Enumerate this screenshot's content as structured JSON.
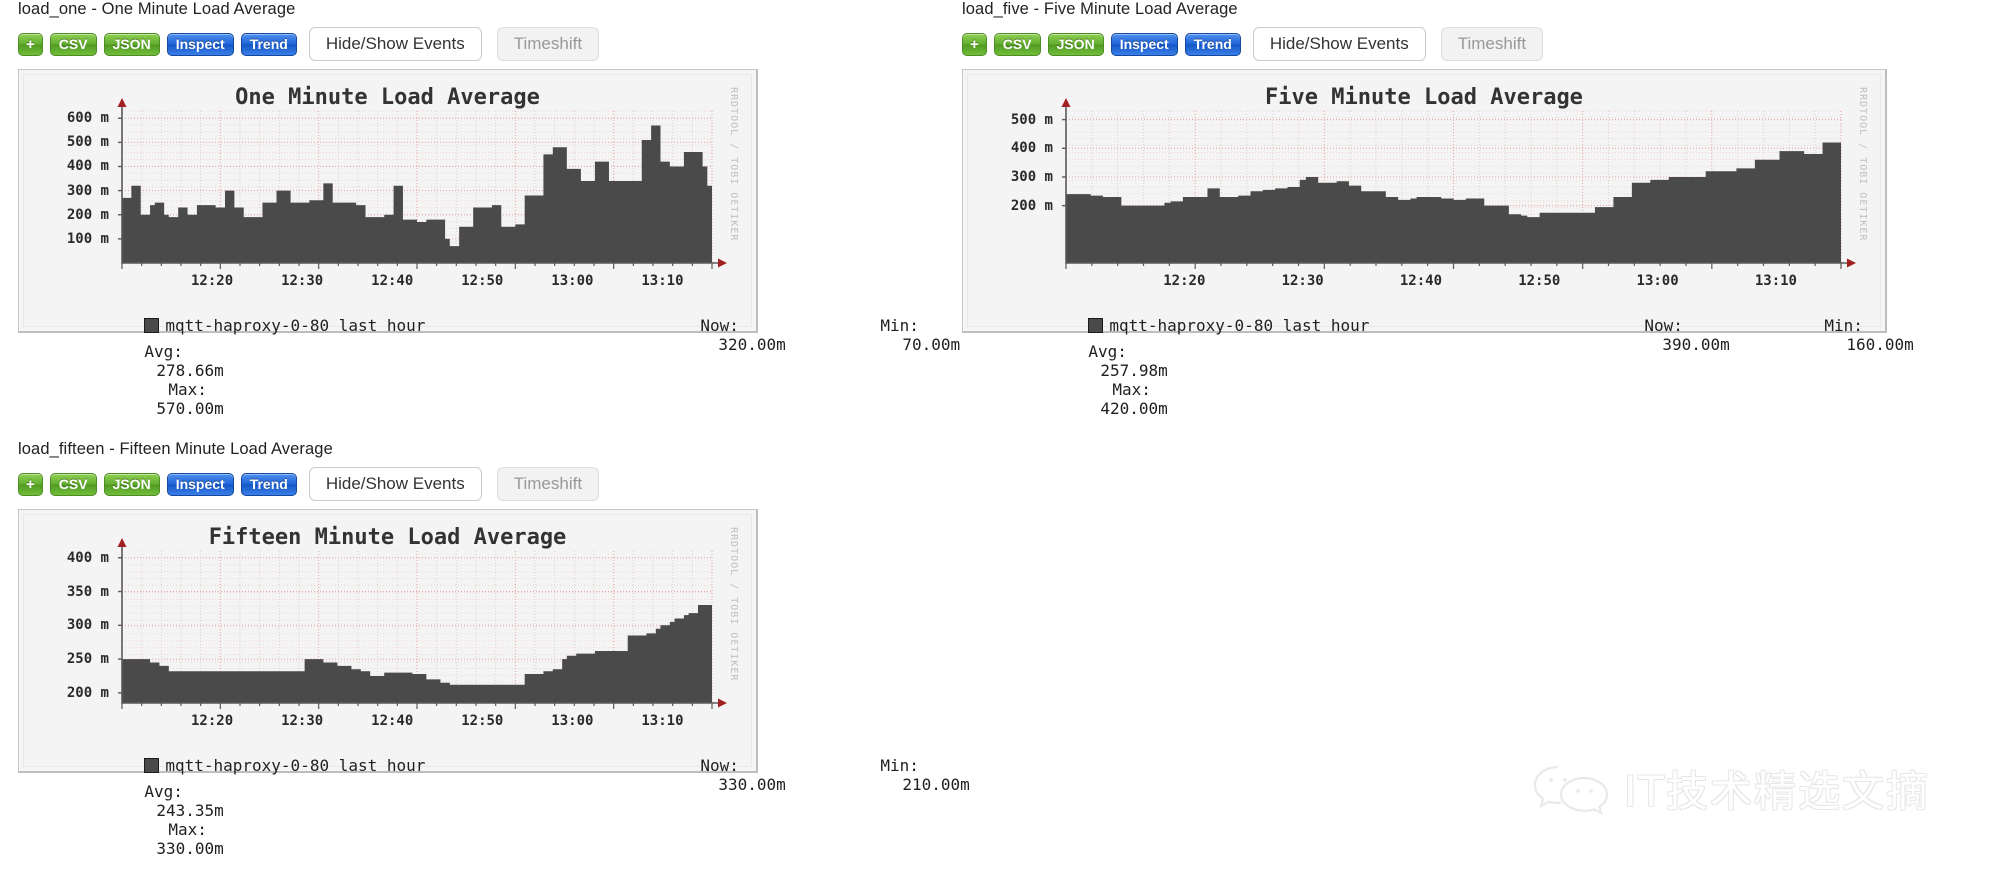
{
  "panels": [
    {
      "header": "load_one - One Minute Load Average",
      "toolbar": {
        "add_label": "+",
        "csv_label": "CSV",
        "json_label": "JSON",
        "inspect_label": "Inspect",
        "trend_label": "Trend",
        "events_label": "Hide/Show Events",
        "timeshift_label": "Timeshift"
      },
      "graph": {
        "watermark": "RRDTOOL / TOBI OETIKER",
        "legend": {
          "series": "mqtt-haproxy-0-80 last hour",
          "now_label": "Now:",
          "now_value": "320.00m",
          "min_label": "Min:",
          "min_value": "70.00m",
          "avg_label": "Avg:",
          "avg_value": "278.66m",
          "max_label": "Max:",
          "max_value": "570.00m"
        }
      },
      "chart_data": {
        "type": "area",
        "title": "One Minute Load Average",
        "xlabel": "",
        "ylabel": "",
        "grid": true,
        "legend_position": "below",
        "series_name": "mqtt-haproxy-0-80 last hour",
        "color": "#4a4a4a",
        "ylim": [
          0,
          630
        ],
        "yticks": [
          100,
          200,
          300,
          400,
          500,
          600
        ],
        "ytick_labels": [
          "100 m",
          "200 m",
          "300 m",
          "400 m",
          "500 m",
          "600 m"
        ],
        "xticks": [
          "12:20",
          "12:30",
          "12:40",
          "12:50",
          "13:00",
          "13:10"
        ],
        "xlim": [
          "12:13",
          "13:13"
        ],
        "summary": {
          "now": 320,
          "min": 70,
          "avg": 278.66,
          "max": 570
        },
        "values": [
          270,
          270,
          320,
          320,
          200,
          200,
          240,
          250,
          250,
          200,
          190,
          190,
          230,
          230,
          200,
          200,
          240,
          240,
          240,
          240,
          230,
          230,
          300,
          300,
          230,
          230,
          190,
          190,
          190,
          190,
          250,
          250,
          250,
          300,
          300,
          300,
          250,
          250,
          250,
          250,
          260,
          260,
          260,
          330,
          330,
          250,
          250,
          250,
          250,
          250,
          240,
          240,
          190,
          190,
          190,
          190,
          200,
          200,
          320,
          320,
          180,
          180,
          180,
          170,
          170,
          180,
          180,
          180,
          180,
          100,
          70,
          70,
          150,
          150,
          150,
          230,
          230,
          230,
          230,
          240,
          240,
          150,
          150,
          150,
          160,
          160,
          280,
          280,
          280,
          280,
          450,
          450,
          480,
          480,
          480,
          390,
          390,
          390,
          340,
          340,
          340,
          420,
          420,
          420,
          340,
          340,
          340,
          340,
          340,
          340,
          340,
          510,
          510,
          570,
          570,
          420,
          420,
          400,
          400,
          400,
          460,
          460,
          460,
          460,
          400,
          320,
          320
        ]
      }
    },
    {
      "header": "load_five - Five Minute Load Average",
      "toolbar": {
        "add_label": "+",
        "csv_label": "CSV",
        "json_label": "JSON",
        "inspect_label": "Inspect",
        "trend_label": "Trend",
        "events_label": "Hide/Show Events",
        "timeshift_label": "Timeshift"
      },
      "graph": {
        "watermark": "RRDTOOL / TOBI OETIKER",
        "legend": {
          "series": "mqtt-haproxy-0-80 last hour",
          "now_label": "Now:",
          "now_value": "390.00m",
          "min_label": "Min:",
          "min_value": "160.00m",
          "avg_label": "Avg:",
          "avg_value": "257.98m",
          "max_label": "Max:",
          "max_value": "420.00m"
        }
      },
      "chart_data": {
        "type": "area",
        "title": "Five Minute Load Average",
        "xlabel": "",
        "ylabel": "",
        "grid": true,
        "legend_position": "below",
        "series_name": "mqtt-haproxy-0-80 last hour",
        "color": "#4a4a4a",
        "ylim": [
          0,
          530
        ],
        "yticks": [
          200,
          300,
          400,
          500
        ],
        "ytick_labels": [
          "200 m",
          "300 m",
          "400 m",
          "500 m"
        ],
        "xticks": [
          "12:20",
          "12:30",
          "12:40",
          "12:50",
          "13:00",
          "13:10"
        ],
        "xlim": [
          "12:13",
          "13:13"
        ],
        "summary": {
          "now": 390,
          "min": 160,
          "avg": 257.98,
          "max": 420
        },
        "values": [
          240,
          240,
          240,
          240,
          235,
          235,
          230,
          230,
          230,
          200,
          200,
          200,
          200,
          200,
          200,
          200,
          210,
          215,
          215,
          230,
          230,
          230,
          230,
          260,
          260,
          230,
          230,
          230,
          235,
          235,
          250,
          250,
          255,
          255,
          260,
          260,
          265,
          265,
          290,
          300,
          300,
          280,
          280,
          280,
          285,
          285,
          270,
          270,
          250,
          250,
          250,
          250,
          230,
          230,
          220,
          220,
          225,
          230,
          230,
          230,
          230,
          225,
          225,
          220,
          220,
          225,
          225,
          225,
          200,
          200,
          200,
          200,
          170,
          170,
          165,
          160,
          160,
          175,
          175,
          175,
          175,
          175,
          175,
          175,
          175,
          175,
          195,
          195,
          195,
          230,
          230,
          230,
          280,
          280,
          280,
          290,
          290,
          290,
          300,
          300,
          300,
          300,
          300,
          300,
          320,
          320,
          320,
          320,
          320,
          330,
          330,
          330,
          360,
          360,
          360,
          360,
          390,
          390,
          390,
          390,
          380,
          380,
          380,
          420,
          420,
          420,
          390
        ]
      }
    },
    {
      "header": "load_fifteen - Fifteen Minute Load Average",
      "toolbar": {
        "add_label": "+",
        "csv_label": "CSV",
        "json_label": "JSON",
        "inspect_label": "Inspect",
        "trend_label": "Trend",
        "events_label": "Hide/Show Events",
        "timeshift_label": "Timeshift"
      },
      "graph": {
        "watermark": "RRDTOOL / TOBI OETIKER",
        "legend": {
          "series": "mqtt-haproxy-0-80 last hour",
          "now_label": "Now:",
          "now_value": "330.00m",
          "min_label": "Min:",
          "min_value": "210.00m",
          "avg_label": "Avg:",
          "avg_value": "243.35m",
          "max_label": "Max:",
          "max_value": "330.00m"
        }
      },
      "chart_data": {
        "type": "area",
        "title": "Fifteen Minute Load Average",
        "xlabel": "",
        "ylabel": "",
        "grid": true,
        "legend_position": "below",
        "series_name": "mqtt-haproxy-0-80 last hour",
        "color": "#4a4a4a",
        "ylim": [
          185,
          410
        ],
        "yticks": [
          200,
          250,
          300,
          350,
          400
        ],
        "ytick_labels": [
          "200 m",
          "250 m",
          "300 m",
          "350 m",
          "400 m"
        ],
        "xticks": [
          "12:20",
          "12:30",
          "12:40",
          "12:50",
          "13:00",
          "13:10"
        ],
        "xlim": [
          "12:13",
          "13:13"
        ],
        "summary": {
          "now": 330,
          "min": 210,
          "avg": 243.35,
          "max": 330
        },
        "values": [
          250,
          250,
          250,
          250,
          250,
          250,
          245,
          245,
          240,
          240,
          232,
          232,
          232,
          232,
          232,
          232,
          232,
          232,
          232,
          232,
          232,
          232,
          232,
          232,
          232,
          232,
          232,
          232,
          232,
          232,
          232,
          232,
          232,
          232,
          232,
          232,
          232,
          232,
          232,
          250,
          250,
          250,
          250,
          245,
          245,
          245,
          240,
          240,
          240,
          235,
          235,
          232,
          232,
          225,
          225,
          225,
          230,
          230,
          230,
          230,
          230,
          230,
          228,
          228,
          228,
          220,
          220,
          220,
          215,
          215,
          212,
          212,
          212,
          212,
          212,
          212,
          212,
          212,
          212,
          212,
          212,
          212,
          212,
          212,
          212,
          212,
          228,
          228,
          228,
          228,
          232,
          232,
          235,
          235,
          250,
          255,
          255,
          258,
          258,
          258,
          258,
          262,
          262,
          262,
          262,
          262,
          262,
          262,
          285,
          285,
          285,
          285,
          288,
          288,
          295,
          300,
          300,
          305,
          310,
          310,
          315,
          318,
          318,
          330,
          330,
          330,
          330
        ]
      }
    }
  ],
  "watermark": {
    "text": "IT技术精选文摘",
    "icon": "wechat-icon"
  }
}
